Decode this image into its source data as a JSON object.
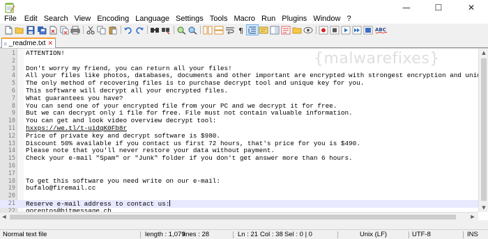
{
  "window": {
    "minimize_glyph": "—",
    "maximize_glyph": "☐",
    "close_glyph": "✕",
    "app_icon": "notepad-plus-plus-icon"
  },
  "menu": [
    "File",
    "Edit",
    "Search",
    "View",
    "Encoding",
    "Language",
    "Settings",
    "Tools",
    "Macro",
    "Run",
    "Plugins",
    "Window",
    "?"
  ],
  "toolbar": {
    "buttons": [
      "new-file",
      "open-file",
      "save",
      "save-all",
      "close",
      "close-all",
      "print",
      "cut",
      "copy",
      "paste",
      "undo",
      "redo",
      "find",
      "replace",
      "zoom-in",
      "zoom-out",
      "sync-vertical",
      "sync-horizontal",
      "word-wrap",
      "show-all-characters",
      "indent-guide",
      "user-defined-language",
      "document-map",
      "function-list",
      "folder-as-workspace",
      "monitoring",
      "record-macro",
      "stop-recording",
      "playback-macro",
      "run-macro-multiple",
      "save-macro",
      "spell-check"
    ],
    "spellcheck_label": "ABC"
  },
  "tab": {
    "label": "_readme.txt",
    "close_glyph": "✕"
  },
  "watermark": "{malwarefixes}",
  "editor": {
    "current_line": 21,
    "lines": [
      {
        "n": "1",
        "text": "ATTENTION!"
      },
      {
        "n": "2",
        "text": ""
      },
      {
        "n": "3",
        "text": "Don't worry my friend, you can return all your files!"
      },
      {
        "n": "4",
        "text": "All your files like photos, databases, documents and other important are encrypted with strongest encryption and unique key."
      },
      {
        "n": "5",
        "text": "The only method of recovering files is to purchase decrypt tool and unique key for you."
      },
      {
        "n": "6",
        "text": "This software will decrypt all your encrypted files."
      },
      {
        "n": "7",
        "text": "What guarantees you have?"
      },
      {
        "n": "8",
        "text": "You can send one of your encrypted file from your PC and we decrypt it for free."
      },
      {
        "n": "9",
        "text": "But we can decrypt only 1 file for free. File must not contain valuable information."
      },
      {
        "n": "10",
        "text": "You can get and look video overview decrypt tool:"
      },
      {
        "n": "11",
        "text": "hxxps://we.tl/t-uidqK0Fb8r"
      },
      {
        "n": "12",
        "text": "Price of private key and decrypt software is $980."
      },
      {
        "n": "13",
        "text": "Discount 50% available if you contact us first 72 hours, that's price for you is $490."
      },
      {
        "n": "14",
        "text": "Please note that you'll never restore your data without payment."
      },
      {
        "n": "15",
        "text": "Check your e-mail \"Spam\" or \"Junk\" folder if you don't get answer more than 6 hours."
      },
      {
        "n": "16",
        "text": ""
      },
      {
        "n": "17",
        "text": ""
      },
      {
        "n": "18",
        "text": "To get this software you need write on our e-mail:"
      },
      {
        "n": "19",
        "text": "bufalo@firemail.cc"
      },
      {
        "n": "20",
        "text": ""
      },
      {
        "n": "21",
        "text": "Reserve e-mail address to contact us:"
      },
      {
        "n": "22",
        "text": "gorentos@bitmessage.ch"
      }
    ]
  },
  "status": {
    "file_type": "Normal text file",
    "length": "length : 1,079",
    "lines": "lines : 28",
    "ln": "Ln : 21",
    "col": "Col : 38",
    "sel": "Sel : 0 | 0",
    "eol": "Unix (LF)",
    "encoding": "UTF-8",
    "mode": "INS"
  }
}
